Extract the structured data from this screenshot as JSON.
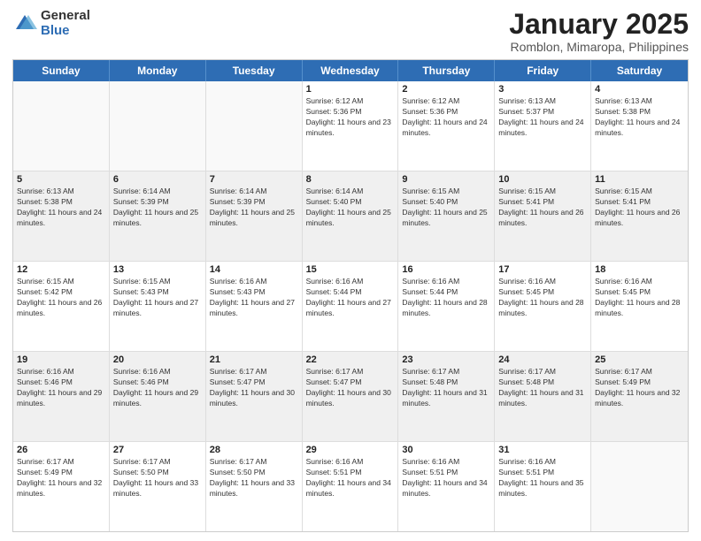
{
  "logo": {
    "general": "General",
    "blue": "Blue"
  },
  "title": {
    "month": "January 2025",
    "location": "Romblon, Mimaropa, Philippines"
  },
  "header_days": [
    "Sunday",
    "Monday",
    "Tuesday",
    "Wednesday",
    "Thursday",
    "Friday",
    "Saturday"
  ],
  "weeks": [
    [
      {
        "day": "",
        "text": ""
      },
      {
        "day": "",
        "text": ""
      },
      {
        "day": "",
        "text": ""
      },
      {
        "day": "1",
        "text": "Sunrise: 6:12 AM\nSunset: 5:36 PM\nDaylight: 11 hours and 23 minutes."
      },
      {
        "day": "2",
        "text": "Sunrise: 6:12 AM\nSunset: 5:36 PM\nDaylight: 11 hours and 24 minutes."
      },
      {
        "day": "3",
        "text": "Sunrise: 6:13 AM\nSunset: 5:37 PM\nDaylight: 11 hours and 24 minutes."
      },
      {
        "day": "4",
        "text": "Sunrise: 6:13 AM\nSunset: 5:38 PM\nDaylight: 11 hours and 24 minutes."
      }
    ],
    [
      {
        "day": "5",
        "text": "Sunrise: 6:13 AM\nSunset: 5:38 PM\nDaylight: 11 hours and 24 minutes."
      },
      {
        "day": "6",
        "text": "Sunrise: 6:14 AM\nSunset: 5:39 PM\nDaylight: 11 hours and 25 minutes."
      },
      {
        "day": "7",
        "text": "Sunrise: 6:14 AM\nSunset: 5:39 PM\nDaylight: 11 hours and 25 minutes."
      },
      {
        "day": "8",
        "text": "Sunrise: 6:14 AM\nSunset: 5:40 PM\nDaylight: 11 hours and 25 minutes."
      },
      {
        "day": "9",
        "text": "Sunrise: 6:15 AM\nSunset: 5:40 PM\nDaylight: 11 hours and 25 minutes."
      },
      {
        "day": "10",
        "text": "Sunrise: 6:15 AM\nSunset: 5:41 PM\nDaylight: 11 hours and 26 minutes."
      },
      {
        "day": "11",
        "text": "Sunrise: 6:15 AM\nSunset: 5:41 PM\nDaylight: 11 hours and 26 minutes."
      }
    ],
    [
      {
        "day": "12",
        "text": "Sunrise: 6:15 AM\nSunset: 5:42 PM\nDaylight: 11 hours and 26 minutes."
      },
      {
        "day": "13",
        "text": "Sunrise: 6:15 AM\nSunset: 5:43 PM\nDaylight: 11 hours and 27 minutes."
      },
      {
        "day": "14",
        "text": "Sunrise: 6:16 AM\nSunset: 5:43 PM\nDaylight: 11 hours and 27 minutes."
      },
      {
        "day": "15",
        "text": "Sunrise: 6:16 AM\nSunset: 5:44 PM\nDaylight: 11 hours and 27 minutes."
      },
      {
        "day": "16",
        "text": "Sunrise: 6:16 AM\nSunset: 5:44 PM\nDaylight: 11 hours and 28 minutes."
      },
      {
        "day": "17",
        "text": "Sunrise: 6:16 AM\nSunset: 5:45 PM\nDaylight: 11 hours and 28 minutes."
      },
      {
        "day": "18",
        "text": "Sunrise: 6:16 AM\nSunset: 5:45 PM\nDaylight: 11 hours and 28 minutes."
      }
    ],
    [
      {
        "day": "19",
        "text": "Sunrise: 6:16 AM\nSunset: 5:46 PM\nDaylight: 11 hours and 29 minutes."
      },
      {
        "day": "20",
        "text": "Sunrise: 6:16 AM\nSunset: 5:46 PM\nDaylight: 11 hours and 29 minutes."
      },
      {
        "day": "21",
        "text": "Sunrise: 6:17 AM\nSunset: 5:47 PM\nDaylight: 11 hours and 30 minutes."
      },
      {
        "day": "22",
        "text": "Sunrise: 6:17 AM\nSunset: 5:47 PM\nDaylight: 11 hours and 30 minutes."
      },
      {
        "day": "23",
        "text": "Sunrise: 6:17 AM\nSunset: 5:48 PM\nDaylight: 11 hours and 31 minutes."
      },
      {
        "day": "24",
        "text": "Sunrise: 6:17 AM\nSunset: 5:48 PM\nDaylight: 11 hours and 31 minutes."
      },
      {
        "day": "25",
        "text": "Sunrise: 6:17 AM\nSunset: 5:49 PM\nDaylight: 11 hours and 32 minutes."
      }
    ],
    [
      {
        "day": "26",
        "text": "Sunrise: 6:17 AM\nSunset: 5:49 PM\nDaylight: 11 hours and 32 minutes."
      },
      {
        "day": "27",
        "text": "Sunrise: 6:17 AM\nSunset: 5:50 PM\nDaylight: 11 hours and 33 minutes."
      },
      {
        "day": "28",
        "text": "Sunrise: 6:17 AM\nSunset: 5:50 PM\nDaylight: 11 hours and 33 minutes."
      },
      {
        "day": "29",
        "text": "Sunrise: 6:16 AM\nSunset: 5:51 PM\nDaylight: 11 hours and 34 minutes."
      },
      {
        "day": "30",
        "text": "Sunrise: 6:16 AM\nSunset: 5:51 PM\nDaylight: 11 hours and 34 minutes."
      },
      {
        "day": "31",
        "text": "Sunrise: 6:16 AM\nSunset: 5:51 PM\nDaylight: 11 hours and 35 minutes."
      },
      {
        "day": "",
        "text": ""
      }
    ]
  ]
}
